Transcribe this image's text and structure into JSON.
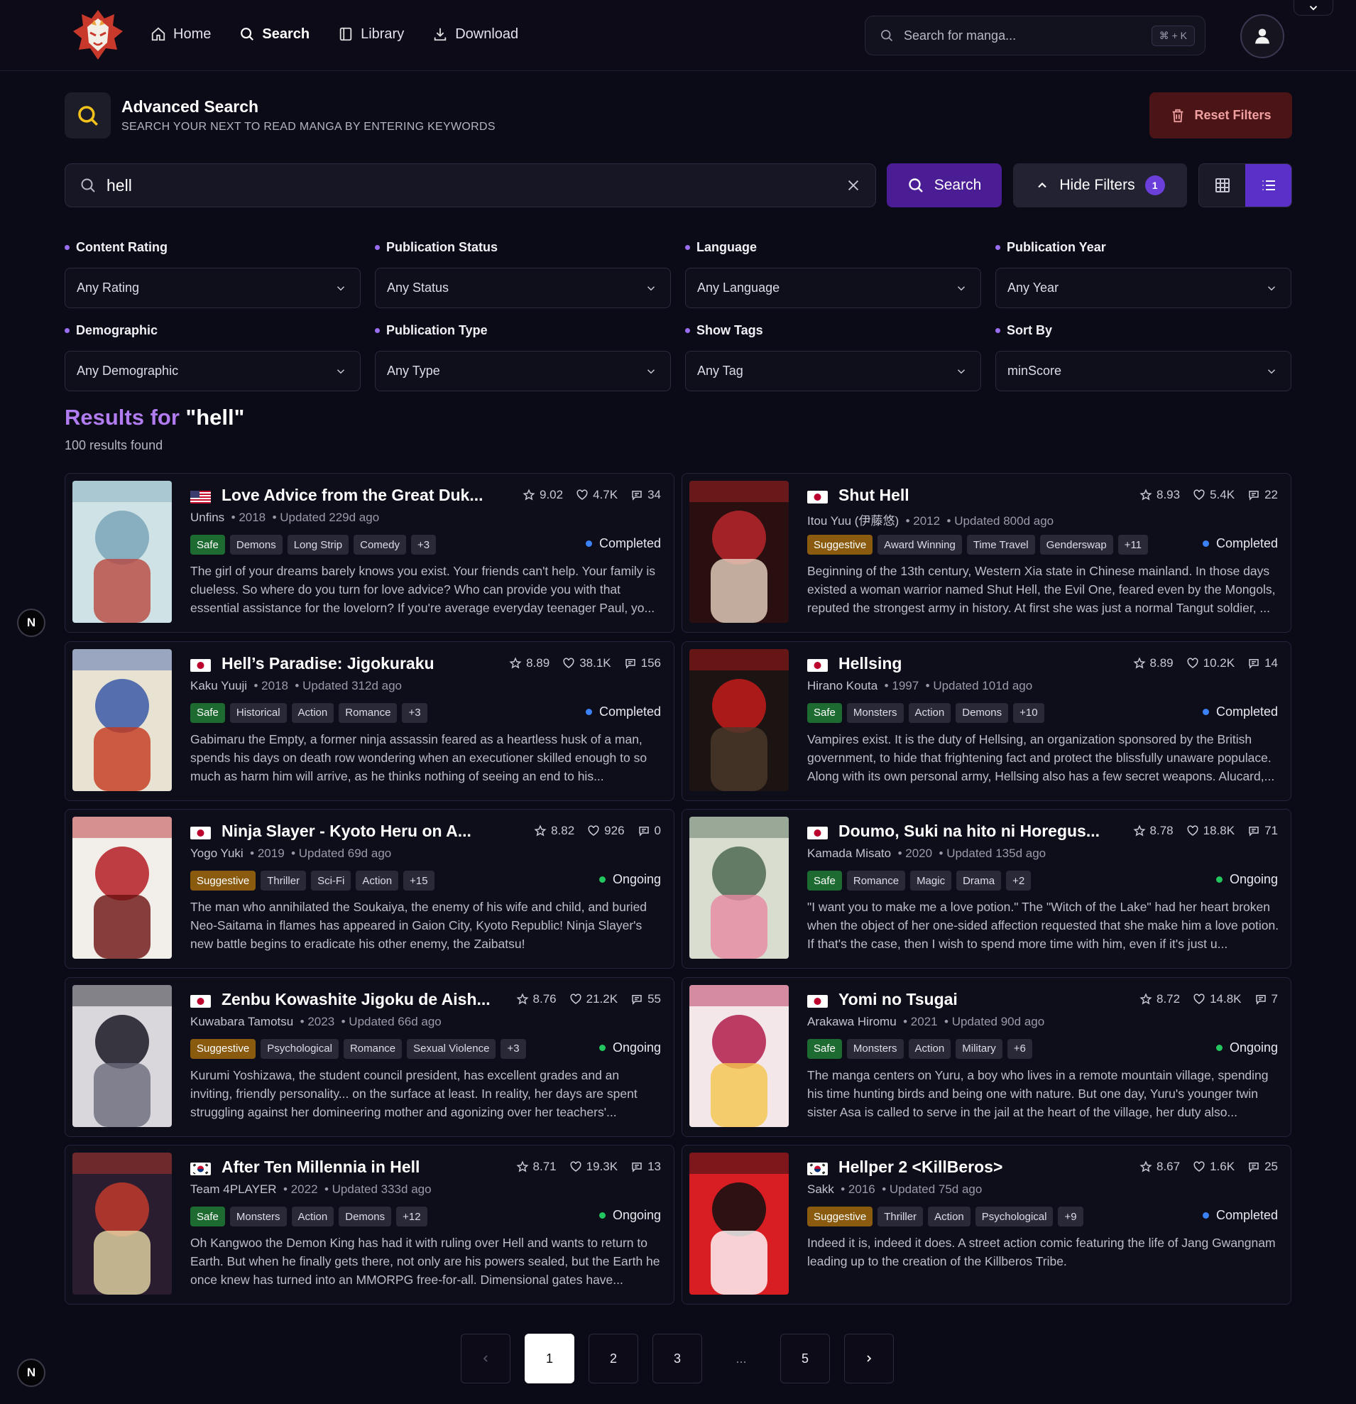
{
  "nav": {
    "items": [
      {
        "label": "Home",
        "icon": "home-icon"
      },
      {
        "label": "Search",
        "icon": "search-icon"
      },
      {
        "label": "Library",
        "icon": "book-icon"
      },
      {
        "label": "Download",
        "icon": "download-icon"
      }
    ],
    "search_placeholder": "Search for manga...",
    "shortcut": "⌘ + K"
  },
  "page": {
    "title": "Advanced Search",
    "subtitle": "SEARCH YOUR NEXT TO READ MANGA BY ENTERING KEYWORDS",
    "reset_label": "Reset Filters"
  },
  "search": {
    "query": "hell",
    "search_label": "Search",
    "hide_filters_label": "Hide Filters",
    "filter_count": "1"
  },
  "filters": [
    {
      "label": "Content Rating",
      "value": "Any Rating"
    },
    {
      "label": "Publication Status",
      "value": "Any Status"
    },
    {
      "label": "Language",
      "value": "Any Language"
    },
    {
      "label": "Publication Year",
      "value": "Any Year"
    },
    {
      "label": "Demographic",
      "value": "Any Demographic"
    },
    {
      "label": "Publication Type",
      "value": "Any Type"
    },
    {
      "label": "Show Tags",
      "value": "Any Tag"
    },
    {
      "label": "Sort By",
      "value": "minScore"
    }
  ],
  "results": {
    "title_prefix": "Results for",
    "query_quoted": "\"hell\"",
    "count_text": "100 results found"
  },
  "colors": {
    "accent": "#6b3fd9",
    "completed": "#3b82f6",
    "ongoing": "#22c55e",
    "safe": "#1d6b31",
    "suggestive": "#8a5b0e"
  },
  "cards": [
    {
      "flag": "us",
      "title": "Love Advice from the Great Duk...",
      "rating": "9.02",
      "likes": "4.7K",
      "comments": "34",
      "author": "Unfins",
      "year": "2018",
      "updated": "Updated 229d ago",
      "tags": [
        "Safe",
        "Demons",
        "Long Strip",
        "Comedy",
        "+3"
      ],
      "status": "Completed",
      "desc": "The girl of your dreams barely knows you exist. Your friends can't help. Your family is clueless. So where do you turn for love advice? Who can provide you with that essential assistance for the lovelorn? If you're average everyday teenager Paul, yo..."
    },
    {
      "flag": "jp",
      "title": "Shut Hell",
      "rating": "8.93",
      "likes": "5.4K",
      "comments": "22",
      "author": "Itou Yuu (伊藤悠)",
      "year": "2012",
      "updated": "Updated 800d ago",
      "tags": [
        "Suggestive",
        "Award Winning",
        "Time Travel",
        "Genderswap",
        "+11"
      ],
      "status": "Completed",
      "desc": "Beginning of the 13th century, Western Xia state in Chinese mainland. In those days existed a woman warrior named Shut Hell, the Evil One, feared even by the Mongols, reputed the strongest army in history. At first she was just a normal Tangut soldier, ..."
    },
    {
      "flag": "jp",
      "title": "Hell’s Paradise: Jigokuraku",
      "rating": "8.89",
      "likes": "38.1K",
      "comments": "156",
      "author": "Kaku Yuuji",
      "year": "2018",
      "updated": "Updated 312d ago",
      "tags": [
        "Safe",
        "Historical",
        "Action",
        "Romance",
        "+3"
      ],
      "status": "Completed",
      "desc": "Gabimaru the Empty, a former ninja assassin feared as a heartless husk of a man, spends his days on death row wondering when an executioner skilled enough to so much as harm him will arrive, as he thinks nothing of seeing an end to his..."
    },
    {
      "flag": "jp",
      "title": "Hellsing",
      "rating": "8.89",
      "likes": "10.2K",
      "comments": "14",
      "author": "Hirano Kouta",
      "year": "1997",
      "updated": "Updated 101d ago",
      "tags": [
        "Safe",
        "Monsters",
        "Action",
        "Demons",
        "+10"
      ],
      "status": "Completed",
      "desc": "Vampires exist. It is the duty of Hellsing, an organization sponsored by the British government, to hide that frightening fact and protect the blissfully unaware populace. Along with its own personal army, Hellsing also has a few secret weapons. Alucard,..."
    },
    {
      "flag": "jp",
      "title": "Ninja Slayer - Kyoto Heru on A...",
      "rating": "8.82",
      "likes": "926",
      "comments": "0",
      "author": "Yogo Yuki",
      "year": "2019",
      "updated": "Updated 69d ago",
      "tags": [
        "Suggestive",
        "Thriller",
        "Sci-Fi",
        "Action",
        "+15"
      ],
      "status": "Ongoing",
      "desc": "The man who annihilated the Soukaiya, the enemy of his wife and child, and buried Neo-Saitama in flames has appeared in Gaion City, Kyoto Republic! Ninja Slayer's new battle begins to eradicate his other enemy, the Zaibatsu!"
    },
    {
      "flag": "jp",
      "title": "Doumo, Suki na hito ni Horegus...",
      "rating": "8.78",
      "likes": "18.8K",
      "comments": "71",
      "author": "Kamada Misato",
      "year": "2020",
      "updated": "Updated 135d ago",
      "tags": [
        "Safe",
        "Romance",
        "Magic",
        "Drama",
        "+2"
      ],
      "status": "Ongoing",
      "desc": "\"I want you to make me a love potion.\" The \"Witch of the Lake\" had her heart broken when the object of her one-sided affection requested that she make him a love potion. If that's the case, then I wish to spend more time with him, even if it's just u..."
    },
    {
      "flag": "jp",
      "title": "Zenbu Kowashite Jigoku de Aish...",
      "rating": "8.76",
      "likes": "21.2K",
      "comments": "55",
      "author": "Kuwabara Tamotsu",
      "year": "2023",
      "updated": "Updated 66d ago",
      "tags": [
        "Suggestive",
        "Psychological",
        "Romance",
        "Sexual Violence",
        "+3"
      ],
      "status": "Ongoing",
      "desc": "Kurumi Yoshizawa, the student council president, has excellent grades and an inviting, friendly personality... on the surface at least. In reality, her days are spent struggling against her domineering mother and agonizing over her teachers'..."
    },
    {
      "flag": "jp",
      "title": "Yomi no Tsugai",
      "rating": "8.72",
      "likes": "14.8K",
      "comments": "7",
      "author": "Arakawa Hiromu",
      "year": "2021",
      "updated": "Updated 90d ago",
      "tags": [
        "Safe",
        "Monsters",
        "Action",
        "Military",
        "+6"
      ],
      "status": "Ongoing",
      "desc": "The manga centers on Yuru, a boy who lives in a remote mountain village, spending his time hunting birds and being one with nature. But one day, Yuru's younger twin sister Asa is called to serve in the jail at the heart of the village, her duty also..."
    },
    {
      "flag": "kr",
      "title": "After Ten Millennia in Hell",
      "rating": "8.71",
      "likes": "19.3K",
      "comments": "13",
      "author": "Team 4PLAYER",
      "year": "2022",
      "updated": "Updated 333d ago",
      "tags": [
        "Safe",
        "Monsters",
        "Action",
        "Demons",
        "+12"
      ],
      "status": "Ongoing",
      "desc": "Oh Kangwoo the Demon King has had it with ruling over Hell and wants to return to Earth. But when he finally gets there, not only are his powers sealed, but the Earth he once knew has turned into an MMORPG free-for-all. Dimensional gates have..."
    },
    {
      "flag": "kr",
      "title": "Hellper 2 <KillBeros>",
      "rating": "8.67",
      "likes": "1.6K",
      "comments": "25",
      "author": "Sakk",
      "year": "2016",
      "updated": "Updated 75d ago",
      "tags": [
        "Suggestive",
        "Thriller",
        "Action",
        "Psychological",
        "+9"
      ],
      "status": "Completed",
      "desc": "Indeed it is, indeed it does. A street action comic featuring the life of Jang Gwangnam leading up to the creation of the Killberos Tribe."
    }
  ],
  "pagination": [
    "1",
    "2",
    "3",
    "...",
    "5"
  ],
  "side_badge": "N"
}
